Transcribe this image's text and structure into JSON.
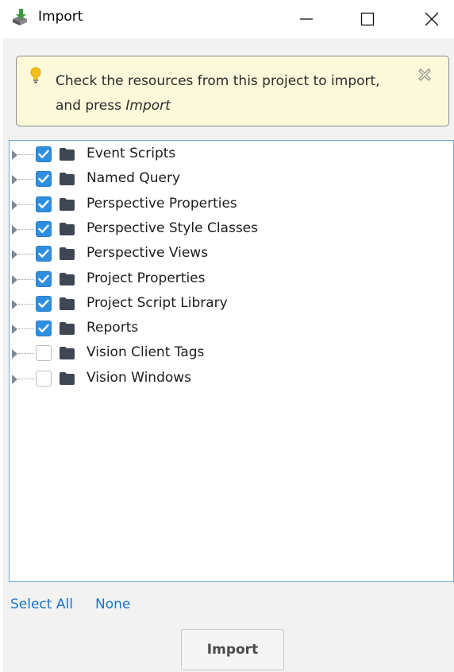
{
  "window": {
    "title": "Import",
    "controls": [
      "minimize",
      "maximize",
      "close"
    ]
  },
  "hint": {
    "text": "Check the resources from this project to import, and press ",
    "emphasis": "Import",
    "icon": "lightbulb-icon",
    "close_icon": "close-hint-icon"
  },
  "tree": {
    "items": [
      {
        "label": "Event Scripts",
        "checked": true
      },
      {
        "label": "Named Query",
        "checked": true
      },
      {
        "label": "Perspective Properties",
        "checked": true
      },
      {
        "label": "Perspective Style Classes",
        "checked": true
      },
      {
        "label": "Perspective Views",
        "checked": true
      },
      {
        "label": "Project Properties",
        "checked": true
      },
      {
        "label": "Project Script Library",
        "checked": true
      },
      {
        "label": "Reports",
        "checked": true
      },
      {
        "label": "Vision Client Tags",
        "checked": false
      },
      {
        "label": "Vision Windows",
        "checked": false
      }
    ]
  },
  "actions": {
    "select_all": "Select All",
    "none": "None",
    "import": "Import"
  },
  "colors": {
    "hint_background": "#fbf9da",
    "checkbox_checked": "#2f8fde",
    "link": "#1a73c9",
    "tree_border": "#6fa7d6",
    "folder": "#3e4753"
  }
}
